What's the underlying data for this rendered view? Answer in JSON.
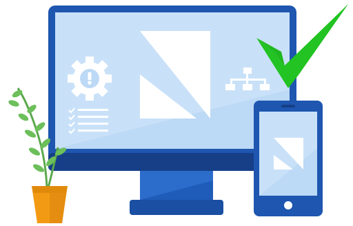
{
  "illustration": {
    "icons": [
      "gear-warning-icon",
      "checklist-icon",
      "sitemap-icon",
      "brand-logo",
      "checkmark-icon",
      "plant-icon"
    ]
  },
  "colors": {
    "frame": "#1e56b0",
    "frame_dark": "#163f88",
    "screen": "#bcd9f5",
    "screen_light": "#d7e9fb",
    "stand": "#1f5cb9",
    "check": "#22c322",
    "pot": "#f39a14",
    "leaf": "#6cbf5a",
    "white": "#ffffff"
  }
}
